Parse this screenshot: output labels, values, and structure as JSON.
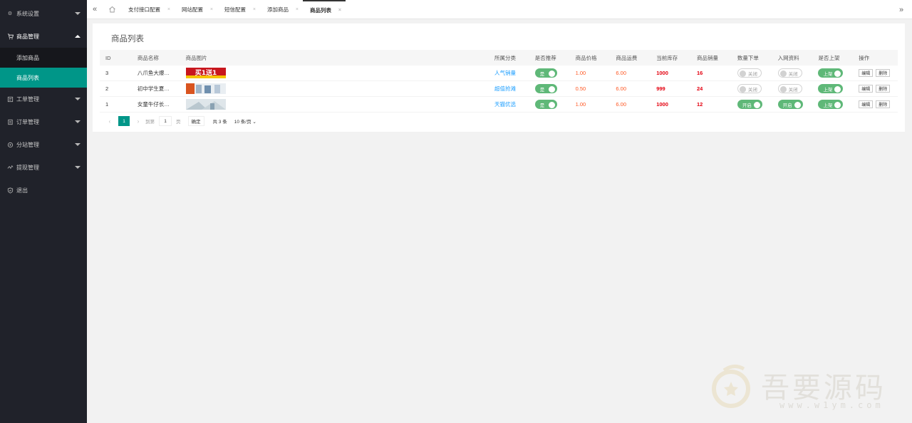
{
  "sidebar": {
    "items": [
      {
        "label": "系统设置",
        "icon": "gear-icon",
        "expanded": false
      },
      {
        "label": "商品管理",
        "icon": "cart-icon",
        "expanded": true,
        "children": [
          {
            "label": "添加商品",
            "active": false
          },
          {
            "label": "商品列表",
            "active": true
          }
        ]
      },
      {
        "label": "工单管理",
        "icon": "ticket-icon",
        "expanded": false
      },
      {
        "label": "订单管理",
        "icon": "order-icon",
        "expanded": false
      },
      {
        "label": "分站管理",
        "icon": "globe-icon",
        "expanded": false
      },
      {
        "label": "提现管理",
        "icon": "withdraw-icon",
        "expanded": false
      },
      {
        "label": "退出",
        "icon": "shield-icon",
        "expanded": null
      }
    ]
  },
  "tabs": [
    {
      "label": "支付接口配置",
      "active": false
    },
    {
      "label": "网站配置",
      "active": false
    },
    {
      "label": "短信配置",
      "active": false
    },
    {
      "label": "添加商品",
      "active": false
    },
    {
      "label": "商品列表",
      "active": true
    }
  ],
  "page": {
    "title": "商品列表"
  },
  "table": {
    "headers": [
      "ID",
      "商品名称",
      "商品图片",
      "所属分类",
      "是否推荐",
      "商品价格",
      "商品运费",
      "当前库存",
      "商品销量",
      "数量下单",
      "入网资料",
      "是否上架",
      "操作"
    ],
    "rows": [
      {
        "id": "3",
        "name": "八爪鱼大爆…",
        "image": "买1送1",
        "category": "人气销量",
        "recommend": "是",
        "price": "1.00",
        "shipping": "6.00",
        "stock": "1000",
        "sales": "16",
        "qty_order": {
          "on": false,
          "label": "关闭"
        },
        "net_info": {
          "on": false,
          "label": "关闭"
        },
        "shelf": {
          "on": true,
          "label": "上架"
        }
      },
      {
        "id": "2",
        "name": "初中学生夏…",
        "image": "",
        "category": "超值抢滩",
        "recommend": "是",
        "price": "0.50",
        "shipping": "6.00",
        "stock": "999",
        "sales": "24",
        "qty_order": {
          "on": false,
          "label": "关闭"
        },
        "net_info": {
          "on": false,
          "label": "关闭"
        },
        "shelf": {
          "on": true,
          "label": "上架"
        }
      },
      {
        "id": "1",
        "name": "女童牛仔长…",
        "image": "",
        "category": "天猫优选",
        "recommend": "是",
        "price": "1.00",
        "shipping": "6.00",
        "stock": "1000",
        "sales": "12",
        "qty_order": {
          "on": true,
          "label": "开启"
        },
        "net_info": {
          "on": true,
          "label": "开启"
        },
        "shelf": {
          "on": true,
          "label": "上架"
        }
      }
    ],
    "actions": {
      "edit": "编辑",
      "delete": "删除"
    }
  },
  "pager": {
    "prev": "‹",
    "current": "1",
    "next": "›",
    "goto_label": "到第",
    "page_input": "1",
    "page_suffix": "页",
    "confirm": "确定",
    "total": "共 3 条",
    "page_size": "10 条/页"
  },
  "watermark": {
    "text": "吾要源码",
    "url": "www.w1ym.com"
  },
  "colors": {
    "sidebar_bg": "#20222a",
    "accent": "#009688",
    "switch_on": "#5fb878",
    "link": "#1e9fff",
    "price": "#ff5722",
    "stock": "#e4000f"
  }
}
